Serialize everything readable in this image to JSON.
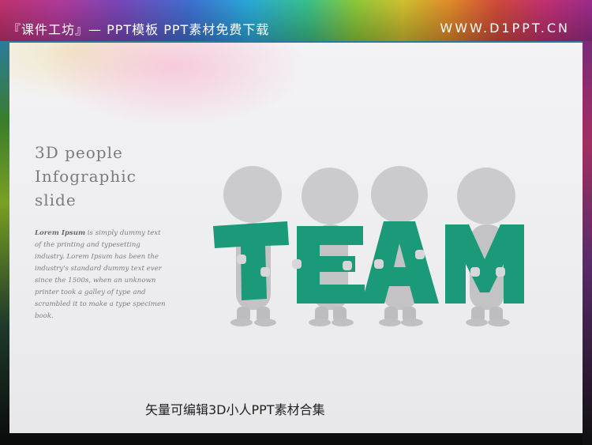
{
  "header": {
    "title": "『课件工坊』— PPT模板 PPT素材免费下载",
    "url": "WWW.D1PPT.CN"
  },
  "slide": {
    "title_lines": [
      "3D people",
      "Infographic",
      "slide"
    ],
    "body_lead": "Lorem Ipsum",
    "body_rest": " is simply dummy text of the printing and typesetting industry. Lorem Ipsum has been the industry's standard dummy text ever since the 1500s, when an unknown printer took a galley of type and scrambled it to make a type specimen book.",
    "graphic_letters": [
      "T",
      "E",
      "A",
      "M"
    ],
    "caption": "矢量可编辑3D小人PPT素材合集"
  },
  "colors": {
    "letter_green": "#1a9a78",
    "figure_gray": "#c9c9cb"
  }
}
